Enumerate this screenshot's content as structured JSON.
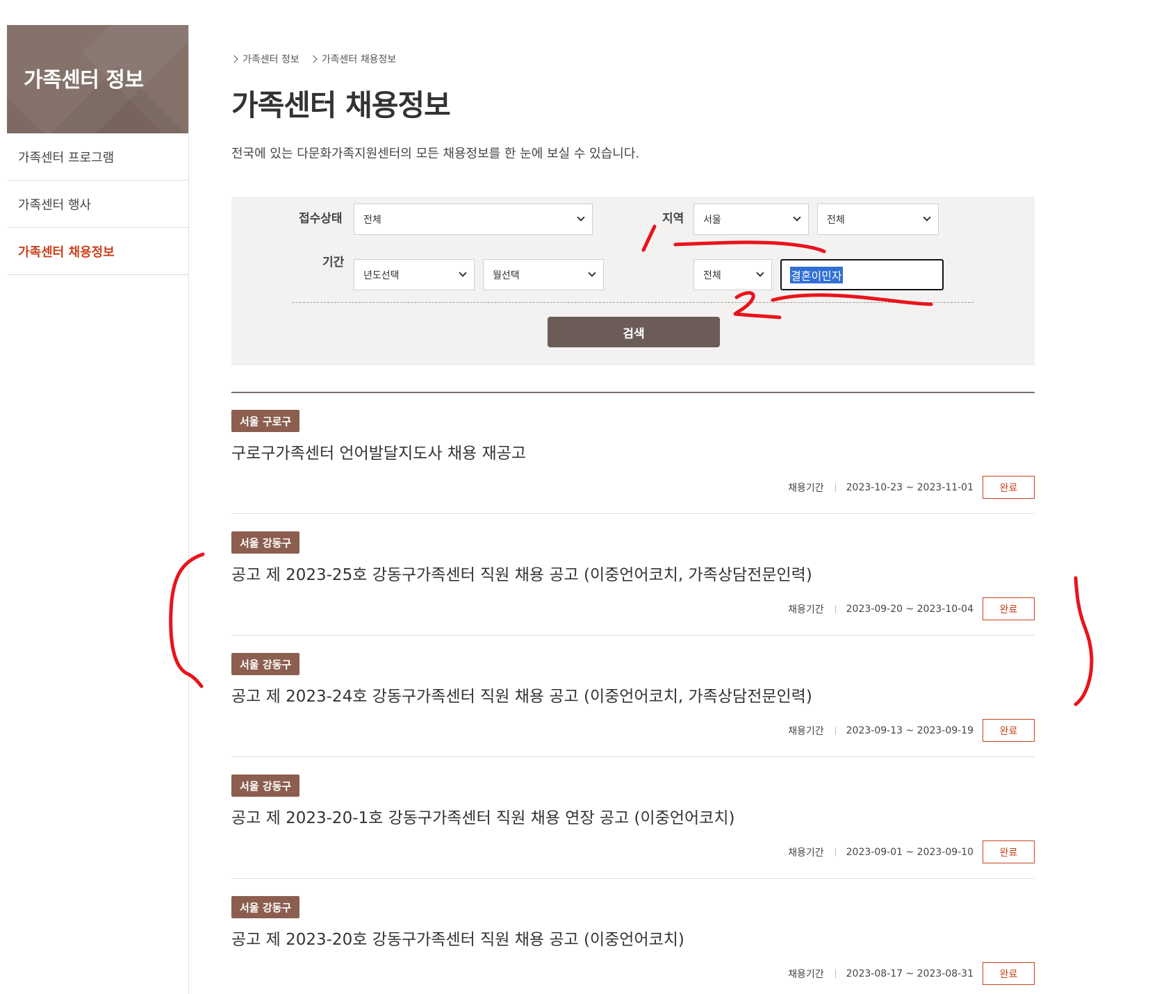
{
  "sidebar": {
    "title": "가족센터 정보",
    "items": [
      {
        "label": "가족센터 프로그램",
        "active": false
      },
      {
        "label": "가족센터 행사",
        "active": false
      },
      {
        "label": "가족센터 채용정보",
        "active": true
      }
    ]
  },
  "breadcrumb": [
    "가족센터 정보",
    "가족센터 채용정보"
  ],
  "page": {
    "title": "가족센터 채용정보",
    "description": "전국에 있는 다문화가족지원센터의 모든 채용정보를 한 눈에 보실 수 있습니다."
  },
  "search": {
    "status_label": "접수상태",
    "status_value": "전체",
    "period_label": "기간",
    "year_value": "년도선택",
    "month_value": "월선택",
    "region_label": "지역",
    "region_value": "서울",
    "district_value": "전체",
    "keyword_type_value": "전체",
    "keyword_value": "결혼이민자",
    "button_label": "검색"
  },
  "list": {
    "period_label": "채용기간",
    "items": [
      {
        "badge": "서울 구로구",
        "title": "구로구가족센터 언어발달지도사 채용 재공고",
        "range": "2023-10-23 ~ 2023-11-01",
        "status": "완료"
      },
      {
        "badge": "서울 강동구",
        "title": "공고 제 2023-25호 강동구가족센터 직원 채용 공고 (이중언어코치, 가족상담전문인력)",
        "range": "2023-09-20 ~ 2023-10-04",
        "status": "완료"
      },
      {
        "badge": "서울 강동구",
        "title": "공고 제 2023-24호 강동구가족센터 직원 채용 공고 (이중언어코치, 가족상담전문인력)",
        "range": "2023-09-13 ~ 2023-09-19",
        "status": "완료"
      },
      {
        "badge": "서울 강동구",
        "title": "공고 제 2023-20-1호 강동구가족센터 직원 채용 연장 공고 (이중언어코치)",
        "range": "2023-09-01 ~ 2023-09-10",
        "status": "완료"
      },
      {
        "badge": "서울 강동구",
        "title": "공고 제 2023-20호 강동구가족센터 직원 채용 공고 (이중언어코치)",
        "range": "2023-08-17 ~ 2023-08-31",
        "status": "완료"
      }
    ]
  },
  "colors": {
    "sidebar_header": "#7d6a62",
    "accent": "#c8431c",
    "badge": "#8b5e4f",
    "search_button": "#6b5c57",
    "annotation": "#e8141b"
  }
}
